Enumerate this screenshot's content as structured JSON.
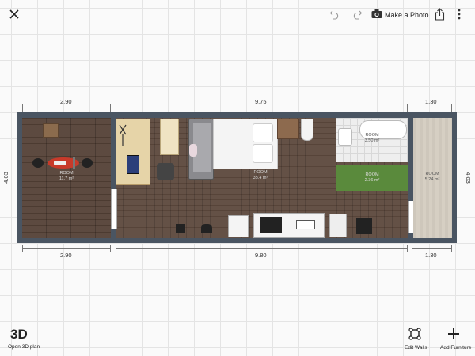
{
  "toolbar": {
    "close_icon": "close-icon",
    "undo_icon": "undo-icon",
    "redo_icon": "redo-icon",
    "camera_icon": "camera-icon",
    "make_photo_label": "Make a Photo",
    "share_icon": "share-icon",
    "more_icon": "more-vertical-icon"
  },
  "dimensions": {
    "top": [
      "2.90",
      "9.75",
      "1.30"
    ],
    "bottom": [
      "2.90",
      "9.80",
      "1.30"
    ],
    "left": "4.03",
    "right": "4.03"
  },
  "rooms": [
    {
      "name": "ROOM",
      "area": "11.7 m²"
    },
    {
      "name": "ROOM",
      "area": "33.4 m²"
    },
    {
      "name": "ROOM",
      "area": "3.50 m²"
    },
    {
      "name": "ROOM",
      "area": "2.36 m²"
    },
    {
      "name": "ROOM",
      "area": "5.24 m²"
    }
  ],
  "bottombar": {
    "three_d_label": "3D",
    "open_3d_label": "Open 3D plan",
    "edit_walls_label": "Edit Walls",
    "add_furniture_label": "Add Furniture"
  },
  "colors": {
    "wall": "#4a5562",
    "floor_wood": "#5e4a3e",
    "grass": "#5a8a3c",
    "deck": "#d6cfc3"
  }
}
